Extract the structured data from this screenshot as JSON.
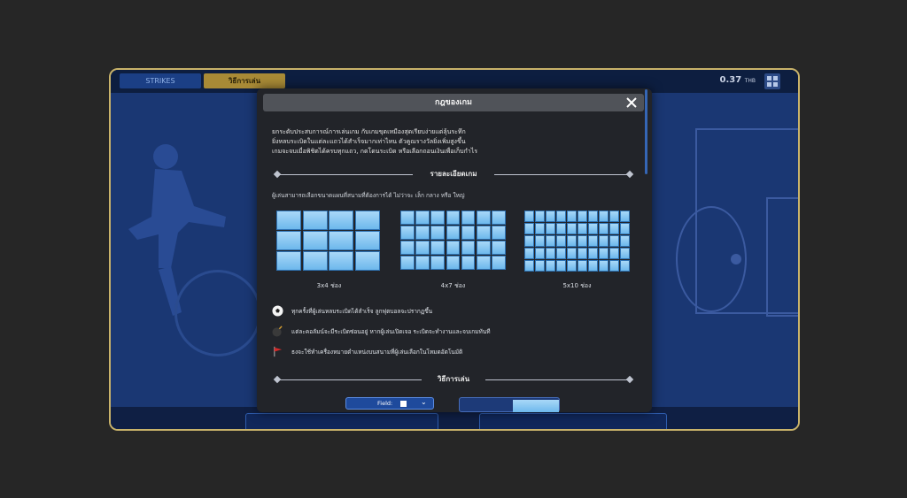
{
  "topbar": {
    "tabs": [
      {
        "label": "STRIKES"
      },
      {
        "label": "วิธีการเล่น"
      }
    ],
    "balance_value": "0.37",
    "balance_currency": "THB"
  },
  "modal": {
    "title": "กฎของเกม",
    "intro_lines": [
      "ยกระดับประสบการณ์การเล่นเกม กับเกมขุดเหมืองสุดเรียบง่ายแต่ลุ้นระทึก",
      "ยิ่งหลบระเบิดในแต่ละแถวได้สำเร็จมากเท่าไหน ตัวคูณรางวัลยิ่งเพิ่มสูงขึ้น",
      "เกมจะจบเมื่อพิชิตได้ครบทุกแถว, กดโดนระเบิด หรือเลือกถอนเงินเพื่อเก็บกำไร"
    ],
    "section_details": "รายละเอียดเกม",
    "details_sub": "ผู้เล่นสามารถเลือกขนาดแผนที่สนามที่ต้องการได้ ไม่ว่าจะ เล็ก กลาง หรือ ใหญ่",
    "grids": [
      {
        "caption": "3x4 ช่อง",
        "rows": 3,
        "cols": 4
      },
      {
        "caption": "4x7 ช่อง",
        "rows": 4,
        "cols": 7
      },
      {
        "caption": "5x10 ช่อง",
        "rows": 5,
        "cols": 10
      }
    ],
    "legend": [
      {
        "icon": "soccer-ball-icon",
        "text": "ทุกครั้งที่ผู้เล่นหลบระเบิดได้สำเร็จ ลูกฟุตบอลจะปรากฏขึ้น"
      },
      {
        "icon": "bomb-icon",
        "text": "แต่ละคอลัมน์จะมีระเบิดซ่อนอยู่ หากผู้เล่นเปิดเจอ ระเบิดจะทำงานและจบเกมทันที"
      },
      {
        "icon": "red-flag-icon",
        "text": "ธงจะใช้ทำเครื่องหมายตำแหน่งบนสนามที่ผู้เล่นเลือกในโหมดอัตโนมัติ"
      }
    ],
    "section_howto": "วิธีการเล่น",
    "preview_field_label": "Field:"
  },
  "colors": {
    "frame_border": "#c9b36a",
    "field_blue": "#1a3773",
    "tab_active": "#a88a36",
    "cell_light": "#a9d8f8"
  }
}
